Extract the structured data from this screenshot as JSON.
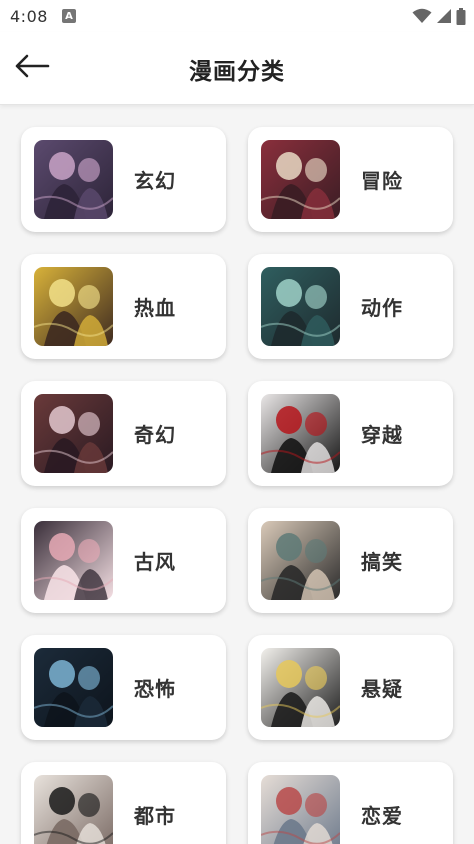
{
  "status_bar": {
    "time": "4:08",
    "notification_badge": "A",
    "icons": [
      "wifi-icon",
      "signal-icon",
      "battery-icon"
    ]
  },
  "app_bar": {
    "title": "漫画分类",
    "back_icon": "arrow-left-icon"
  },
  "categories": [
    {
      "label": "玄幻",
      "cover_colors": [
        "#5b4a6e",
        "#c9a3c7",
        "#2d2438"
      ]
    },
    {
      "label": "冒险",
      "cover_colors": [
        "#8a2f3c",
        "#e9d9c4",
        "#3a1d24"
      ]
    },
    {
      "label": "热血",
      "cover_colors": [
        "#d8b23a",
        "#f2e08a",
        "#3e2a20"
      ]
    },
    {
      "label": "动作",
      "cover_colors": [
        "#2f5e5f",
        "#9fd1c8",
        "#1e2a2e"
      ]
    },
    {
      "label": "奇幻",
      "cover_colors": [
        "#6a3a3a",
        "#e3c8cf",
        "#2a1a22"
      ]
    },
    {
      "label": "穿越",
      "cover_colors": [
        "#e9e6e6",
        "#b5151b",
        "#151515"
      ]
    },
    {
      "label": "古风",
      "cover_colors": [
        "#3a2f3a",
        "#e6a9b5",
        "#f4dfe3"
      ]
    },
    {
      "label": "搞笑",
      "cover_colors": [
        "#d9c9b8",
        "#5e7a77",
        "#2a2a2a"
      ]
    },
    {
      "label": "恐怖",
      "cover_colors": [
        "#1c2b3a",
        "#7db4d4",
        "#0d141c"
      ]
    },
    {
      "label": "悬疑",
      "cover_colors": [
        "#f2f0ec",
        "#e6c85a",
        "#1e1e1e"
      ]
    },
    {
      "label": "都市",
      "cover_colors": [
        "#e8e2dc",
        "#1a1a1a",
        "#7a6a64"
      ]
    },
    {
      "label": "恋爱",
      "cover_colors": [
        "#e6ddd6",
        "#b94a4a",
        "#6d7a8c"
      ]
    }
  ]
}
